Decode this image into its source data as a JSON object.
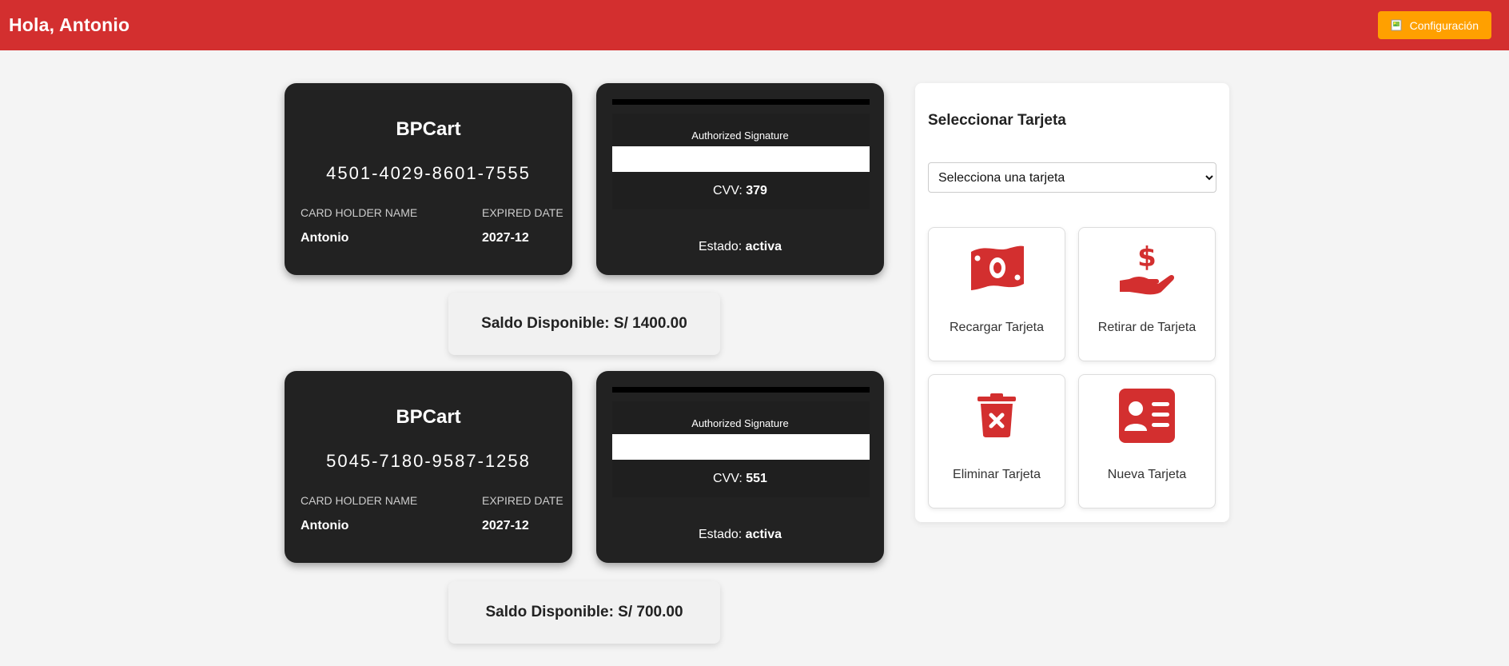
{
  "header": {
    "greeting": "Hola, Antonio",
    "config_label": "Configuración"
  },
  "cards": [
    {
      "brand": "BPCart",
      "number": "4501-4029-8601-7555",
      "holder_label": "CARD HOLDER NAME",
      "holder": "Antonio",
      "expiry_label": "EXPIRED DATE",
      "expiry": "2027-12",
      "signature_label": "Authorized Signature",
      "cvv_label": "CVV:",
      "cvv": "379",
      "estado_label": "Estado:",
      "estado": "activa",
      "balance": "Saldo Disponible: S/ 1400.00"
    },
    {
      "brand": "BPCart",
      "number": "5045-7180-9587-1258",
      "holder_label": "CARD HOLDER NAME",
      "holder": "Antonio",
      "expiry_label": "EXPIRED DATE",
      "expiry": "2027-12",
      "signature_label": "Authorized Signature",
      "cvv_label": "CVV:",
      "cvv": "551",
      "estado_label": "Estado:",
      "estado": "activa",
      "balance": "Saldo Disponible: S/ 700.00"
    }
  ],
  "panel": {
    "title": "Seleccionar Tarjeta",
    "select_value": "Selecciona una tarjeta",
    "actions": [
      {
        "label": "Recargar Tarjeta",
        "icon": "money-bill-icon"
      },
      {
        "label": "Retirar de Tarjeta",
        "icon": "hand-dollar-icon"
      },
      {
        "label": "Eliminar Tarjeta",
        "icon": "trash-x-icon"
      },
      {
        "label": "Nueva Tarjeta",
        "icon": "id-card-icon"
      }
    ]
  },
  "colors": {
    "header_bg": "#d32f2f",
    "config_button_bg": "#ffa000",
    "card_bg": "#222222",
    "icon_red": "#d32f2f"
  }
}
